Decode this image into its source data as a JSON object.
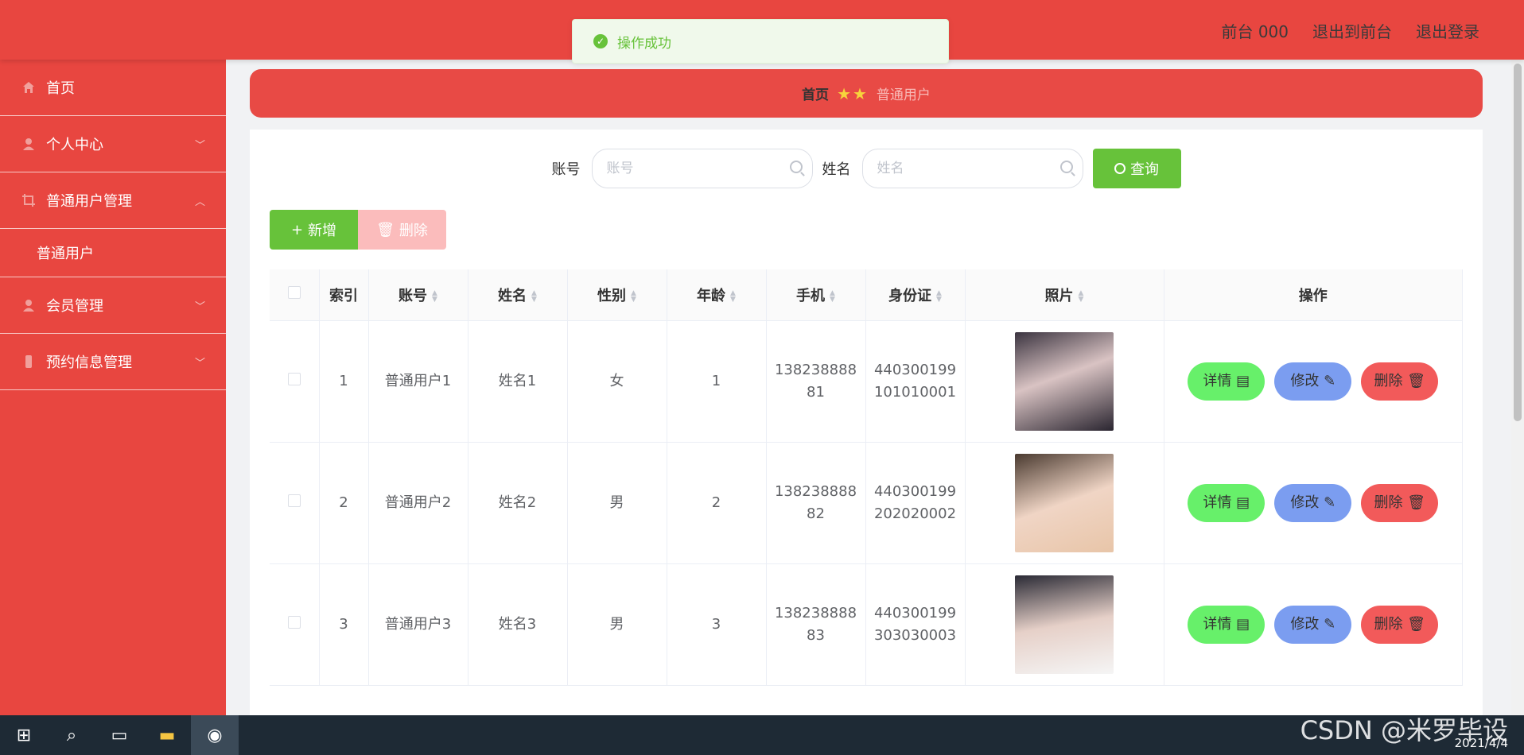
{
  "header": {
    "links": [
      "前台 000",
      "退出到前台",
      "退出登录"
    ]
  },
  "toast": {
    "message": "操作成功"
  },
  "sidebar": {
    "items": [
      {
        "label": "首页",
        "icon": "home-icon"
      },
      {
        "label": "个人中心",
        "icon": "user-icon"
      },
      {
        "label": "普通用户管理",
        "icon": "crop-icon"
      },
      {
        "label": "普通用户",
        "icon": ""
      },
      {
        "label": "会员管理",
        "icon": "user-icon"
      },
      {
        "label": "预约信息管理",
        "icon": "phone-icon"
      }
    ]
  },
  "breadcrumb": {
    "home": "首页",
    "stars": "★★",
    "current": "普通用户"
  },
  "search": {
    "account_label": "账号",
    "account_placeholder": "账号",
    "name_label": "姓名",
    "name_placeholder": "姓名",
    "query_label": "查询"
  },
  "actions": {
    "add_label": "新增",
    "delete_label": "删除"
  },
  "table": {
    "headers": [
      "索引",
      "账号",
      "姓名",
      "性别",
      "年龄",
      "手机",
      "身份证",
      "照片",
      "操作"
    ],
    "rows": [
      {
        "index": "1",
        "account": "普通用户1",
        "name": "姓名1",
        "gender": "女",
        "age": "1",
        "phone_a": "138238888",
        "phone_b": "81",
        "id_a": "440300199",
        "id_b": "101010001"
      },
      {
        "index": "2",
        "account": "普通用户2",
        "name": "姓名2",
        "gender": "男",
        "age": "2",
        "phone_a": "138238888",
        "phone_b": "82",
        "id_a": "440300199",
        "id_b": "202020002"
      },
      {
        "index": "3",
        "account": "普通用户3",
        "name": "姓名3",
        "gender": "男",
        "age": "3",
        "phone_a": "138238888",
        "phone_b": "83",
        "id_a": "440300199",
        "id_b": "303030003"
      }
    ],
    "btn_detail": "详情",
    "btn_edit": "修改",
    "btn_delete": "删除"
  },
  "taskbar": {
    "date": "2021/4/4"
  },
  "watermark": "CSDN @米罗毕设",
  "colors": {
    "brand": "#e84640",
    "success": "#67c23a",
    "edit": "#7b9df0",
    "danger": "#f25a5a"
  }
}
